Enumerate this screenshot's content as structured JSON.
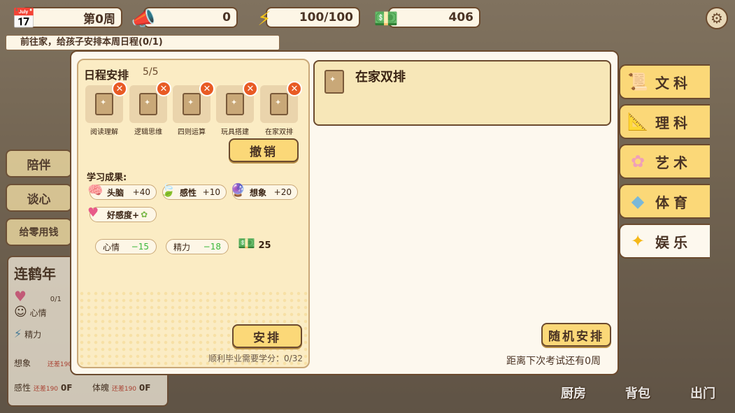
{
  "topbar": {
    "week": "第0周",
    "megaphone": "0",
    "energy": "100/100",
    "money": "406"
  },
  "task_text": "前往家，给孩子安排本周日程(0/1)",
  "side_buttons": [
    "陪伴",
    "谈心",
    "给零用钱"
  ],
  "character": {
    "name": "连鹤年",
    "rows": [
      {
        "label": "",
        "value": "0/1"
      },
      {
        "label": "心情",
        "value": ""
      },
      {
        "label": "精力",
        "value": ""
      }
    ],
    "stats": [
      {
        "label": "想象",
        "note": "还差190",
        "value": ""
      },
      {
        "label": "感性",
        "note": "还差190",
        "value": "0F"
      },
      {
        "label": "体魄",
        "note": "还差190",
        "value": "0F"
      }
    ]
  },
  "schedule": {
    "title": "日程安排",
    "count": "5/5",
    "slots": [
      "阅读理解",
      "逻辑思维",
      "四则运算",
      "玩具搭建",
      "在家双排"
    ],
    "cancel": "撤销",
    "results_title": "学习成果:",
    "results": [
      {
        "label": "头脑",
        "value": "+40"
      },
      {
        "label": "感性",
        "value": "+10"
      },
      {
        "label": "想象",
        "value": "+20"
      },
      {
        "label": "好感度+",
        "value": ""
      }
    ],
    "costs": [
      {
        "label": "心情",
        "value": "−15"
      },
      {
        "label": "精力",
        "value": "−18"
      }
    ],
    "money_cost": "25",
    "arrange": "安排",
    "credits": "顺利毕业需要学分：0/32"
  },
  "detail": {
    "title": "在家双排"
  },
  "random_button": "随机安排",
  "next_exam": "距离下次考试还有0周",
  "tabs": [
    {
      "label": "文科",
      "icon": "scroll-icon"
    },
    {
      "label": "理科",
      "icon": "ruler-icon"
    },
    {
      "label": "艺术",
      "icon": "flower-icon"
    },
    {
      "label": "体育",
      "icon": "cube-icon"
    },
    {
      "label": "娱乐",
      "icon": "star-icon"
    }
  ],
  "bottom": [
    "厨房",
    "背包",
    "出门"
  ]
}
